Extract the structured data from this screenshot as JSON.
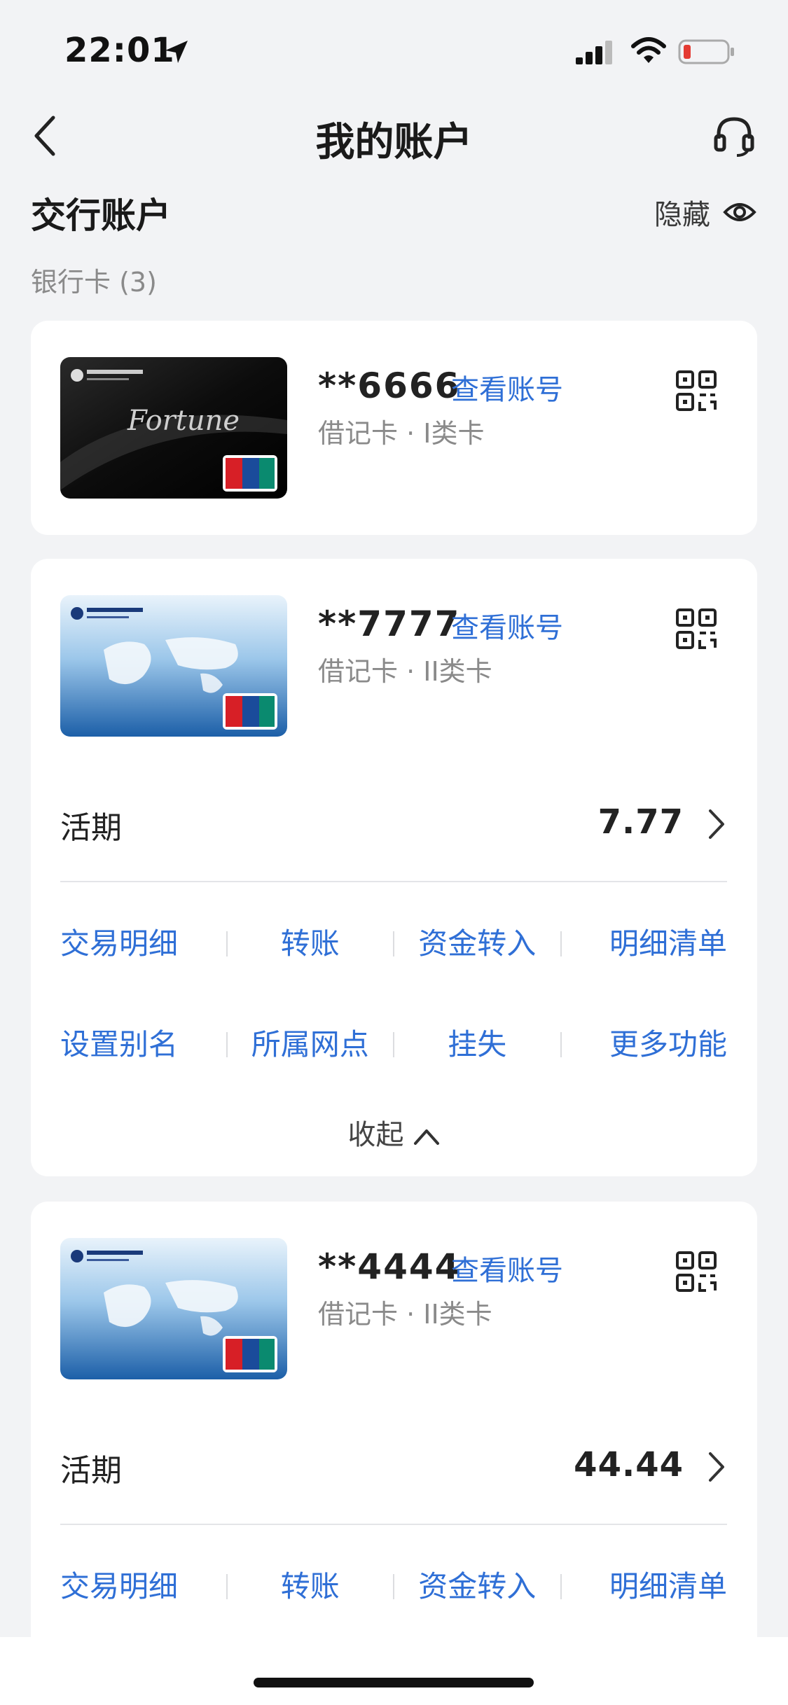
{
  "status": {
    "time": "22:01"
  },
  "nav": {
    "title": "我的账户"
  },
  "section": {
    "title": "交行账户",
    "hide_label": "隐藏",
    "subtitle": "银行卡 (3)"
  },
  "cards": [
    {
      "number": "**6666",
      "view_label": "查看账号",
      "type": "借记卡 · I类卡",
      "card_brand": "Fortune"
    },
    {
      "number": "**7777",
      "view_label": "查看账号",
      "type": "借记卡 · II类卡",
      "balance_label": "活期",
      "balance": "7.77",
      "actions_row1": [
        "交易明细",
        "转账",
        "资金转入",
        "明细清单"
      ],
      "actions_row2": [
        "设置别名",
        "所属网点",
        "挂失",
        "更多功能"
      ],
      "collapse_label": "收起"
    },
    {
      "number": "**4444",
      "view_label": "查看账号",
      "type": "借记卡 · II类卡",
      "balance_label": "活期",
      "balance": "44.44",
      "actions_row1": [
        "交易明细",
        "转账",
        "资金转入",
        "明细清单"
      ]
    }
  ],
  "colors": {
    "accent": "#2f6fd6",
    "background": "#f2f3f5"
  },
  "icons": [
    "location-arrow-icon",
    "signal-icon",
    "wifi-icon",
    "battery-icon",
    "back-chevron-icon",
    "headset-icon",
    "eye-icon",
    "qr-code-icon",
    "chevron-right-icon",
    "chevron-up-icon"
  ]
}
